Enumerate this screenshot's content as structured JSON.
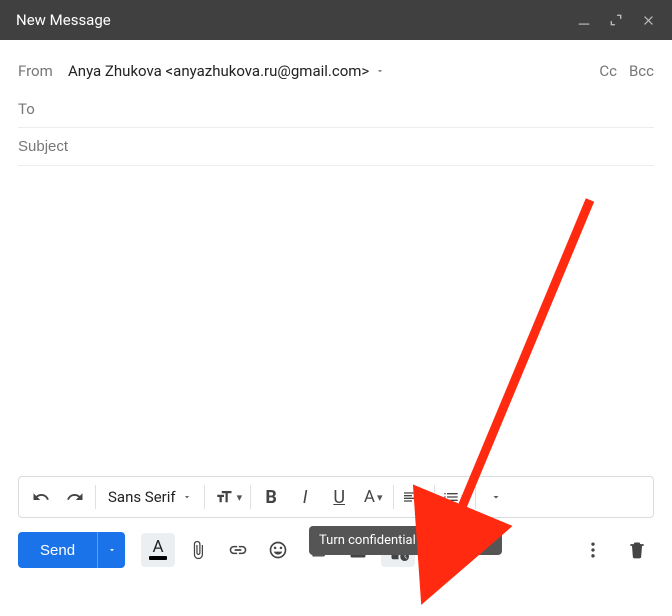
{
  "titlebar": {
    "title": "New Message"
  },
  "header": {
    "from_label": "From",
    "from_value": "Anya Zhukova <anyazhukova.ru@gmail.com>",
    "cc_label": "Cc",
    "bcc_label": "Bcc",
    "to_label": "To",
    "to_value": "",
    "subject_placeholder": "Subject",
    "subject_value": ""
  },
  "format": {
    "font": "Sans Serif",
    "bold": "B",
    "italic": "I",
    "underline": "U"
  },
  "toolbar": {
    "send_label": "Send",
    "tooltip": "Turn confidential mode on/off"
  }
}
